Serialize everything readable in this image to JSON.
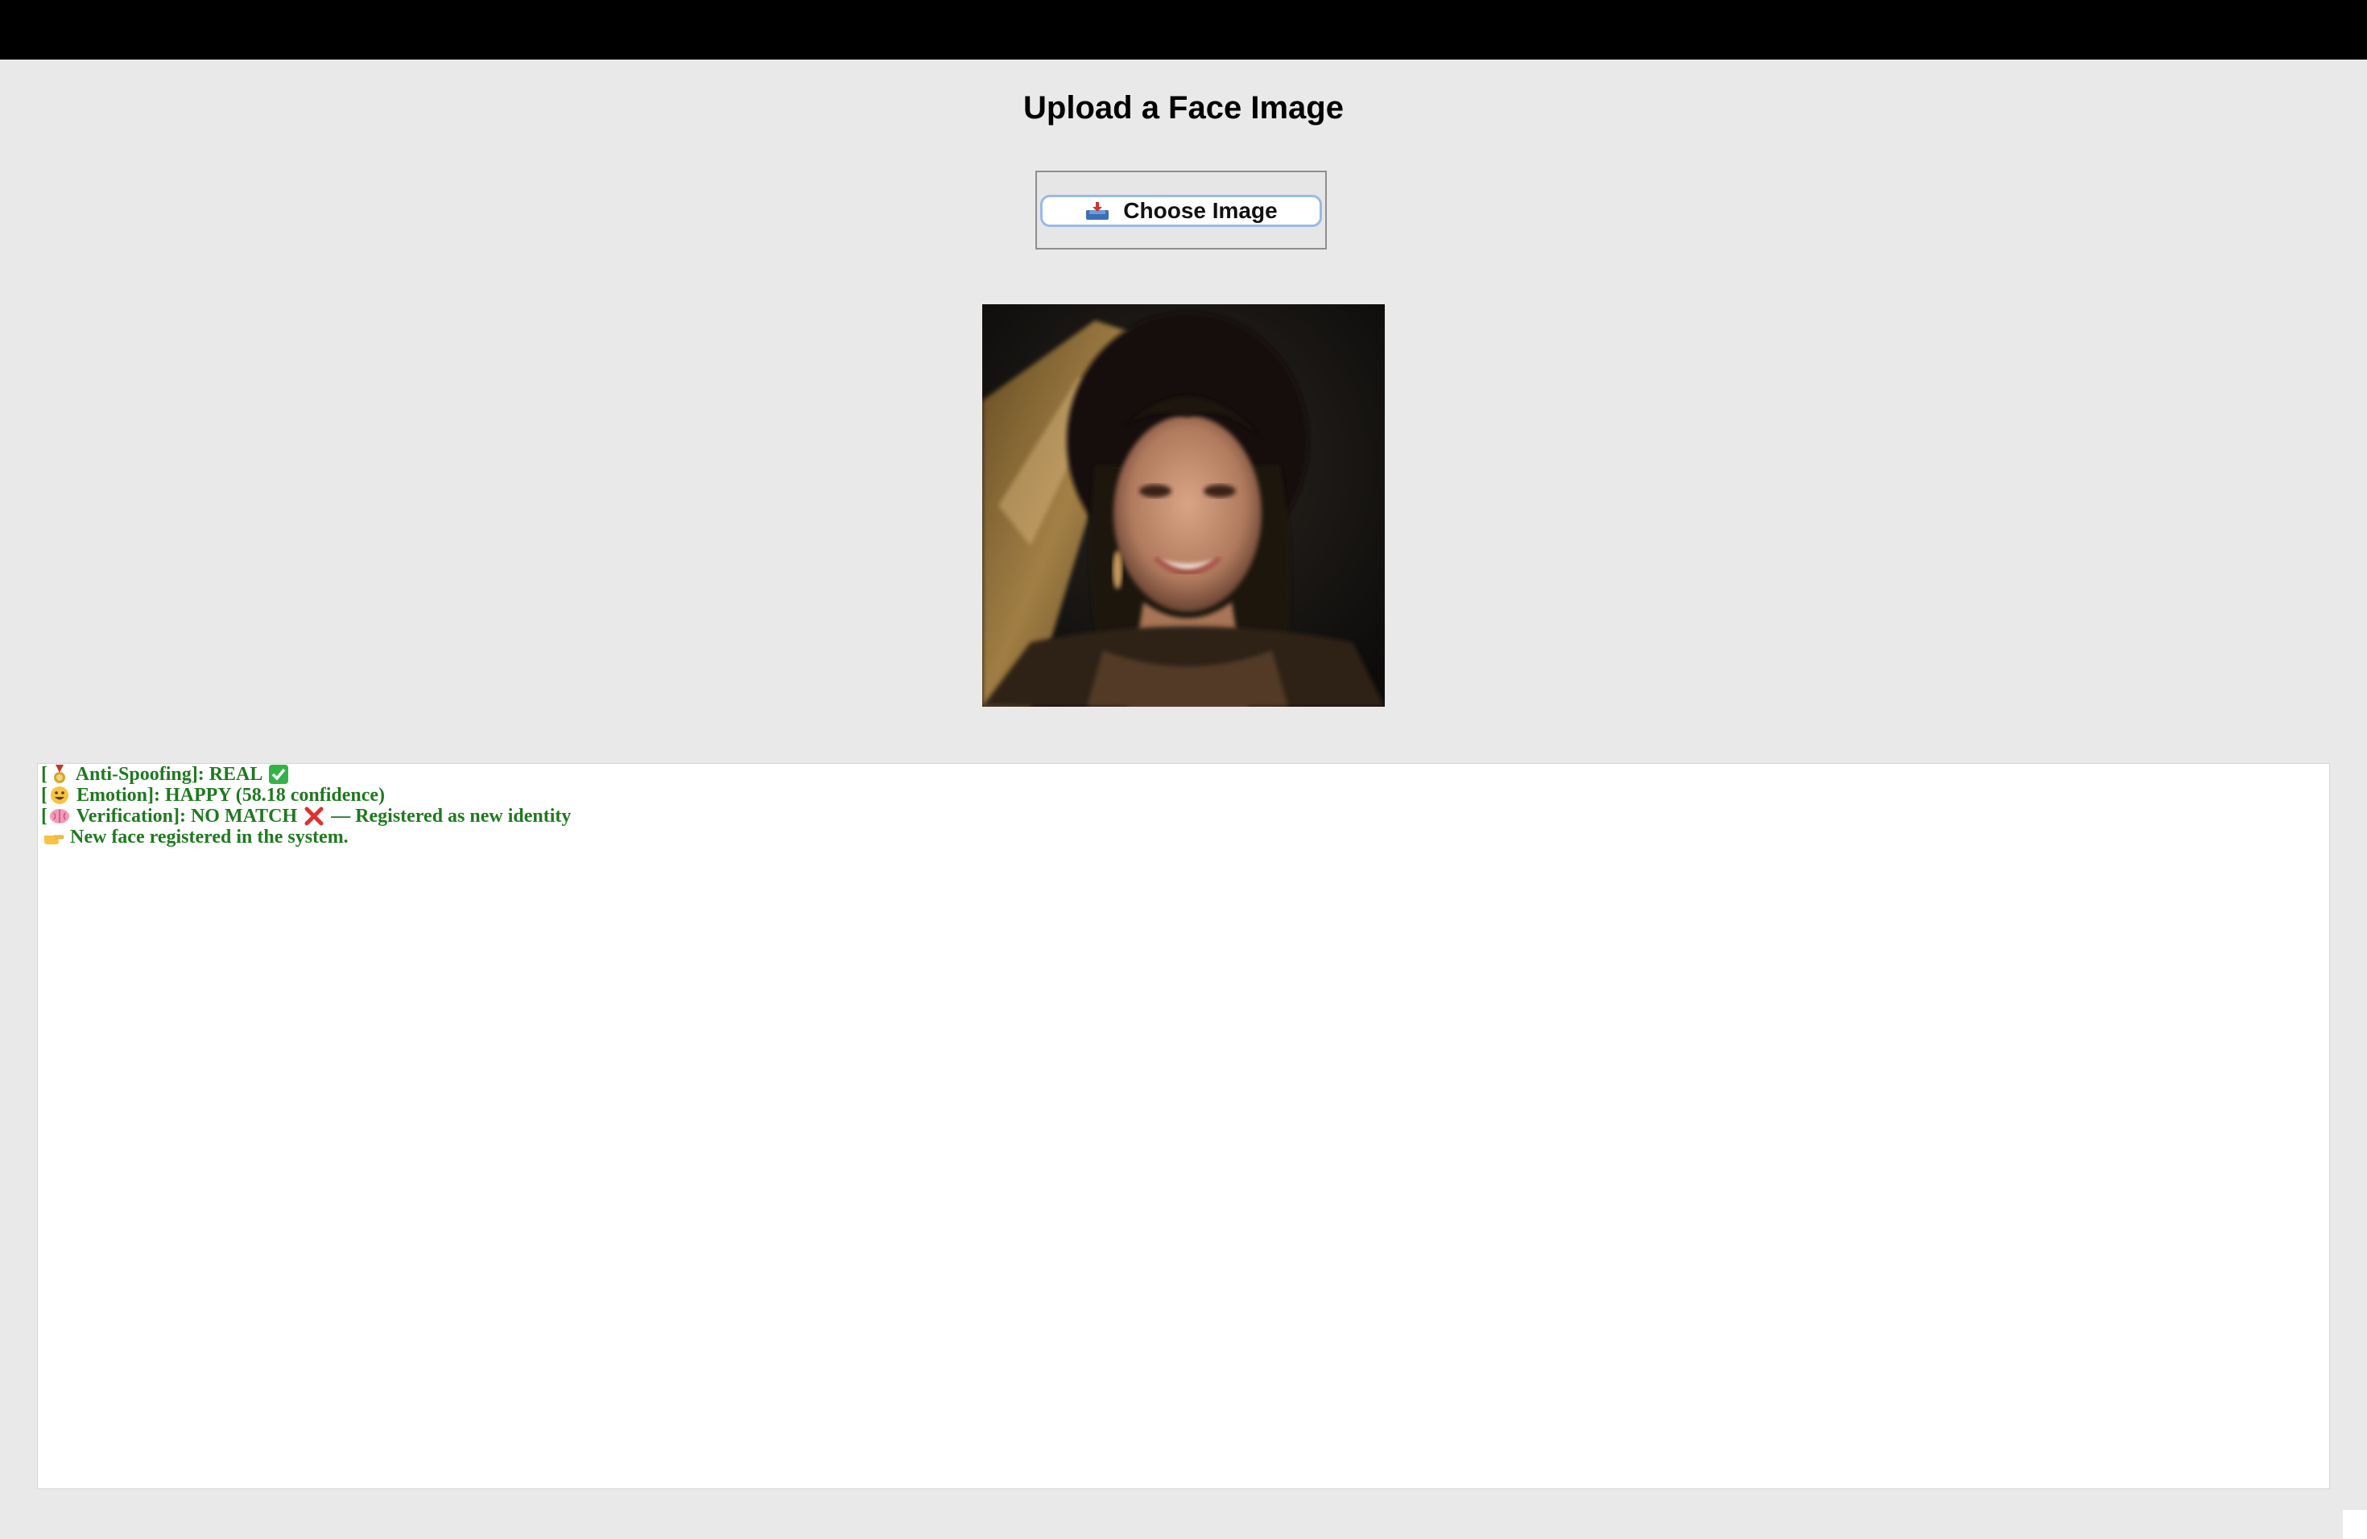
{
  "header": {
    "title": "Upload a Face Image"
  },
  "upload": {
    "button_label": "Choose Image",
    "button_icon": "inbox-tray-icon"
  },
  "photo": {
    "alt": "face-photo"
  },
  "output": {
    "lines": [
      {
        "icon": "medal-icon",
        "prefix": "[",
        "text": " Anti-Spoofing]: REAL ",
        "suffix_icon": "check-mark-icon"
      },
      {
        "icon": "smiley-icon",
        "prefix": "[",
        "text": " Emotion]: HAPPY (58.18 confidence)"
      },
      {
        "icon": "brain-icon",
        "prefix": "[",
        "text": " Verification]: NO MATCH ",
        "suffix_icon": "cross-mark-icon",
        "tail": " — Registered as new identity"
      },
      {
        "icon": "pointing-hand-icon",
        "prefix": "",
        "text": " New face registered in the system."
      }
    ],
    "text_color": "#1f7a1f"
  },
  "colors": {
    "background": "#e9e9e9",
    "titlebar": "#000000",
    "button_border": "#9ab8ea"
  }
}
